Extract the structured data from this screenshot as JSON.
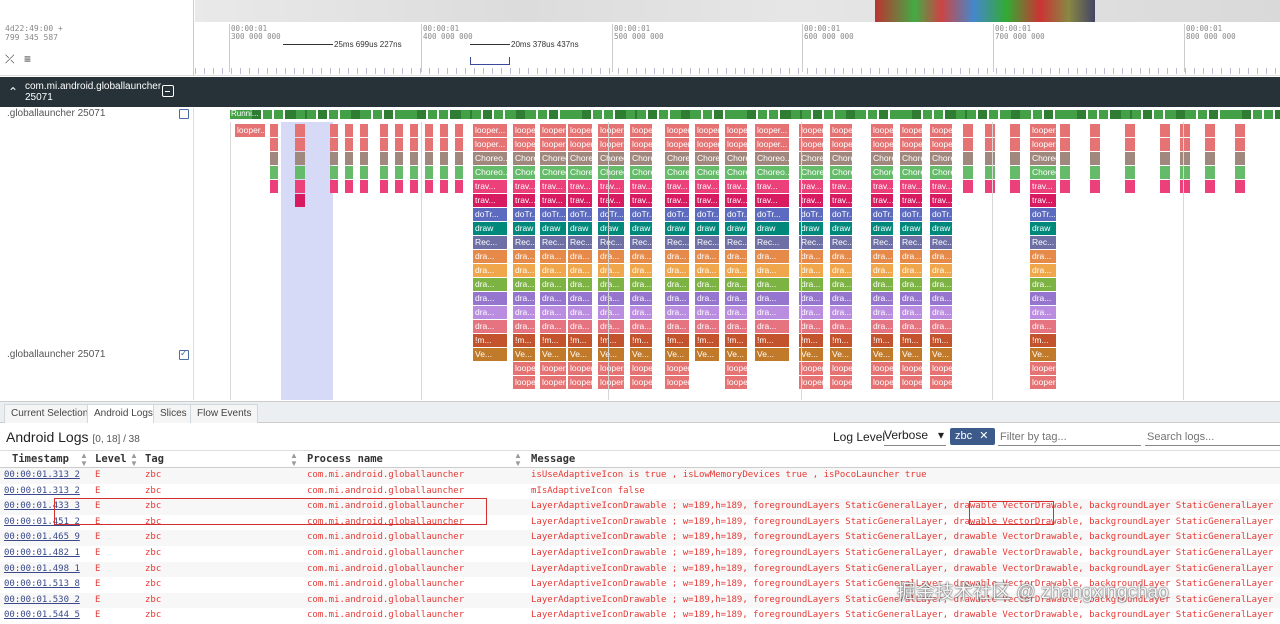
{
  "ruler": {
    "left_timestamp_line1": "4d22:49:00 +",
    "left_timestamp_line2": "799 345 587",
    "ticks": [
      {
        "top": "00:00:01",
        "bottom": "300 000 000"
      },
      {
        "top": "00:00:01",
        "bottom": "400 000 000"
      },
      {
        "top": "00:00:01",
        "bottom": "500 000 000"
      },
      {
        "top": "00:00:01",
        "bottom": "600 000 000"
      },
      {
        "top": "00:00:01",
        "bottom": "700 000 000"
      },
      {
        "top": "00:00:01",
        "bottom": "800 000 000"
      }
    ],
    "span_labels": [
      "25ms 699us 227ns",
      "20ms 378us 437ns"
    ],
    "controls": {
      "collapse_icon": "⤫",
      "menu_icon": "≡"
    }
  },
  "group": {
    "title_line1": "com.mi.android.globallauncher",
    "title_line2": "25071",
    "chevron": "⌃"
  },
  "tracks": [
    {
      "name": ".globallauncher 25071",
      "checked": false
    },
    {
      "name": ".globallauncher 25071",
      "checked": true
    }
  ],
  "thread_label": "Runni...",
  "tabs": [
    "Current Selection",
    "Android Logs",
    "Slices",
    "Flow Events"
  ],
  "logs": {
    "title": "Android Logs",
    "range": "[0, 18] / 38",
    "log_level_label": "Log Level",
    "log_level_value": "Verbose",
    "tag_chip": "zbc",
    "tag_chip_close": "✕",
    "tag_filter_placeholder": "Filter by tag...",
    "search_placeholder": "Search logs...",
    "columns": [
      "Timestamp",
      "Level",
      "Tag",
      "Process name",
      "Message"
    ],
    "rows": [
      {
        "ts": "00:00:01.313 2",
        "level": "E",
        "tag": "zbc",
        "process": "com.mi.android.globallauncher",
        "message": "isUseAdaptiveIcon is true , isLowMemoryDevices true , isPocoLauncher true"
      },
      {
        "ts": "00:00:01.313 2",
        "level": "E",
        "tag": "zbc",
        "process": "com.mi.android.globallauncher",
        "message": "mIsAdaptiveIcon false"
      },
      {
        "ts": "00:00:01.433 3",
        "level": "E",
        "tag": "zbc",
        "process": "com.mi.android.globallauncher",
        "message": "LayerAdaptiveIconDrawable ; w=189,h=189, foregroundLayers StaticGeneralLayer, drawable VectorDrawable, backgroundLayer StaticGeneralLayer"
      },
      {
        "ts": "00:00:01.451 2",
        "level": "E",
        "tag": "zbc",
        "process": "com.mi.android.globallauncher",
        "message": "LayerAdaptiveIconDrawable ; w=189,h=189, foregroundLayers StaticGeneralLayer, drawable VectorDrawable, backgroundLayer StaticGeneralLayer"
      },
      {
        "ts": "00:00:01.465 9",
        "level": "E",
        "tag": "zbc",
        "process": "com.mi.android.globallauncher",
        "message": "LayerAdaptiveIconDrawable ; w=189,h=189, foregroundLayers StaticGeneralLayer, drawable VectorDrawable, backgroundLayer StaticGeneralLayer"
      },
      {
        "ts": "00:00:01.482 1",
        "level": "E",
        "tag": "zbc",
        "process": "com.mi.android.globallauncher",
        "message": "LayerAdaptiveIconDrawable ; w=189,h=189, foregroundLayers StaticGeneralLayer, drawable VectorDrawable, backgroundLayer StaticGeneralLayer"
      },
      {
        "ts": "00:00:01.498 1",
        "level": "E",
        "tag": "zbc",
        "process": "com.mi.android.globallauncher",
        "message": "LayerAdaptiveIconDrawable ; w=189,h=189, foregroundLayers StaticGeneralLayer, drawable VectorDrawable, backgroundLayer StaticGeneralLayer"
      },
      {
        "ts": "00:00:01.513 8",
        "level": "E",
        "tag": "zbc",
        "process": "com.mi.android.globallauncher",
        "message": "LayerAdaptiveIconDrawable ; w=189,h=189, foregroundLayers StaticGeneralLayer, drawable VectorDrawable, backgroundLayer StaticGeneralLayer"
      },
      {
        "ts": "00:00:01.530 2",
        "level": "E",
        "tag": "zbc",
        "process": "com.mi.android.globallauncher",
        "message": "LayerAdaptiveIconDrawable ; w=189,h=189, foregroundLayers StaticGeneralLayer, drawable VectorDrawable, backgroundLayer StaticGeneralLayer"
      },
      {
        "ts": "00:00:01.544 5",
        "level": "E",
        "tag": "zbc",
        "process": "com.mi.android.globallauncher",
        "message": "LayerAdaptiveIconDrawable ; w=189,h=189, foregroundLayers StaticGeneralLayer, drawable VectorDrawable, backgroundLayer StaticGeneralLayer"
      }
    ]
  },
  "slice_labels": [
    "looper...",
    "Choreo...",
    "trav...",
    "doTr...",
    "draw",
    "Rec...",
    "dra...",
    "!m...",
    "Ve..."
  ],
  "watermark": "掘金技术社区 @ zhangxingchao",
  "colors": {
    "header_bg": "#263238",
    "log_error": "#e53935",
    "chip_bg": "#3c5a8a",
    "highlight_box": "#d32f2f"
  }
}
